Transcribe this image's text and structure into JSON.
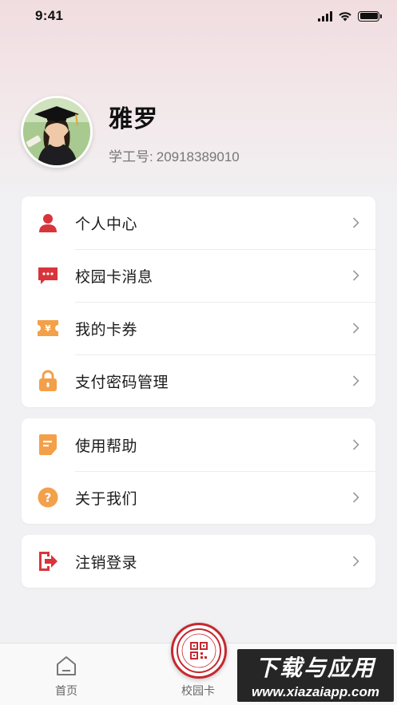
{
  "status_bar": {
    "time": "9:41"
  },
  "profile": {
    "name": "雅罗",
    "id_label": "学工号:",
    "id_value": "20918389010"
  },
  "menu_group_1": [
    {
      "label": "个人中心",
      "icon": "person-icon",
      "color": "#d9343b"
    },
    {
      "label": "校园卡消息",
      "icon": "message-icon",
      "color": "#d9343b"
    },
    {
      "label": "我的卡券",
      "icon": "coupon-icon",
      "color": "#f3a04a"
    },
    {
      "label": "支付密码管理",
      "icon": "lock-icon",
      "color": "#f3a04a"
    }
  ],
  "menu_group_2": [
    {
      "label": "使用帮助",
      "icon": "document-icon",
      "color": "#f3a04a"
    },
    {
      "label": "关于我们",
      "icon": "question-icon",
      "color": "#f3a04a"
    }
  ],
  "menu_group_3": [
    {
      "label": "注销登录",
      "icon": "logout-icon",
      "color": "#d9343b"
    }
  ],
  "tabbar": {
    "home_label": "首页",
    "card_label": "校园卡",
    "accent": "#c6282f"
  },
  "watermark": {
    "main": "下载与应用",
    "sub": "www.xiazaiapp.com"
  }
}
